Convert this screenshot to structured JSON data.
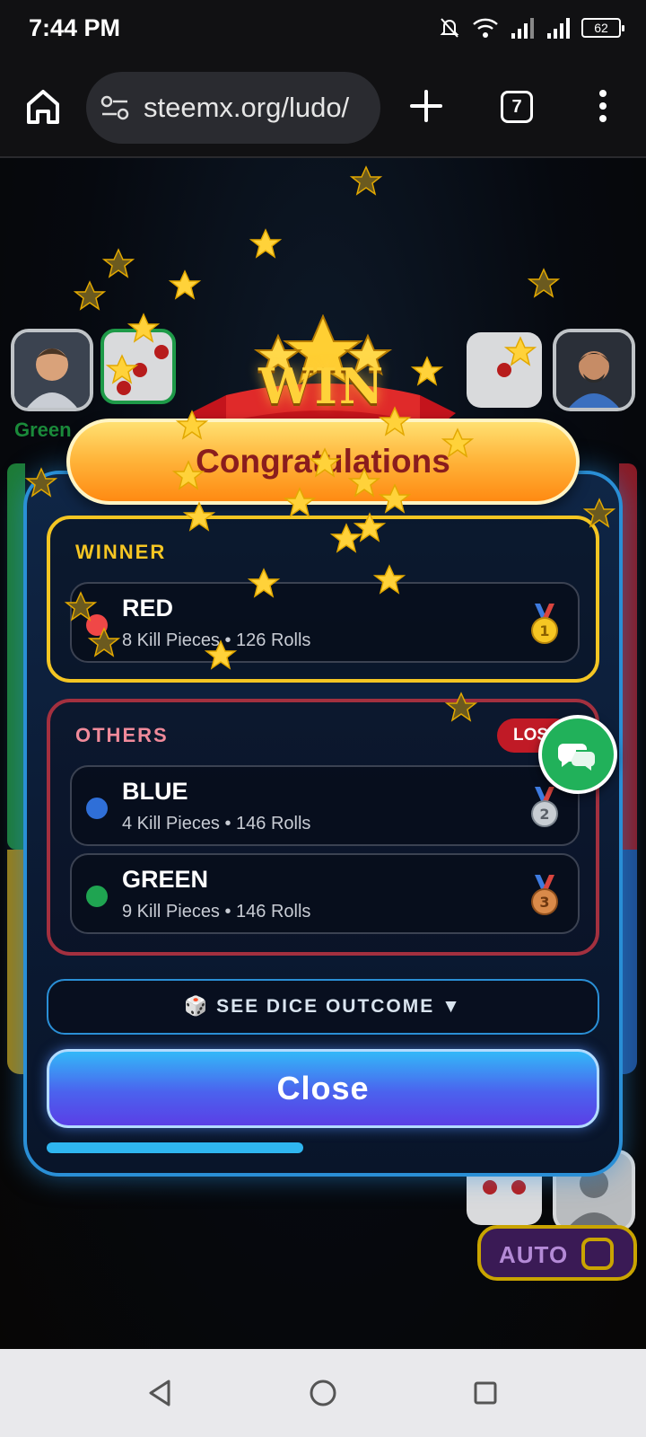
{
  "status_bar": {
    "time": "7:44 PM",
    "battery": "62"
  },
  "browser": {
    "url": "steemx.org/ludo/",
    "tab_count": "7"
  },
  "game": {
    "green_label": "Green",
    "auto_label": "AUTO"
  },
  "banner": {
    "win_text": "WIN",
    "title": "Congratulations"
  },
  "winner": {
    "section_title": "WINNER",
    "player": {
      "name": "RED",
      "stats": "8 Kill Pieces • 126 Rolls",
      "color": "#f04747",
      "medal": "gold-medal-1"
    }
  },
  "others": {
    "section_title": "OTHERS",
    "badge": "LOST",
    "players": [
      {
        "name": "BLUE",
        "stats": "4 Kill Pieces • 146 Rolls",
        "color": "#2f6fd8",
        "medal": "silver-medal-2"
      },
      {
        "name": "GREEN",
        "stats": "9 Kill Pieces • 146 Rolls",
        "color": "#1fa451",
        "medal": "bronze-medal-3"
      }
    ]
  },
  "actions": {
    "dice_outcome": "🎲 SEE DICE OUTCOME ▼",
    "close": "Close"
  },
  "colors": {
    "modal_border": "#2a8fd6",
    "winner_border": "#f4c623",
    "others_border": "#a3303f",
    "accent_orange": "#ff8a12"
  }
}
